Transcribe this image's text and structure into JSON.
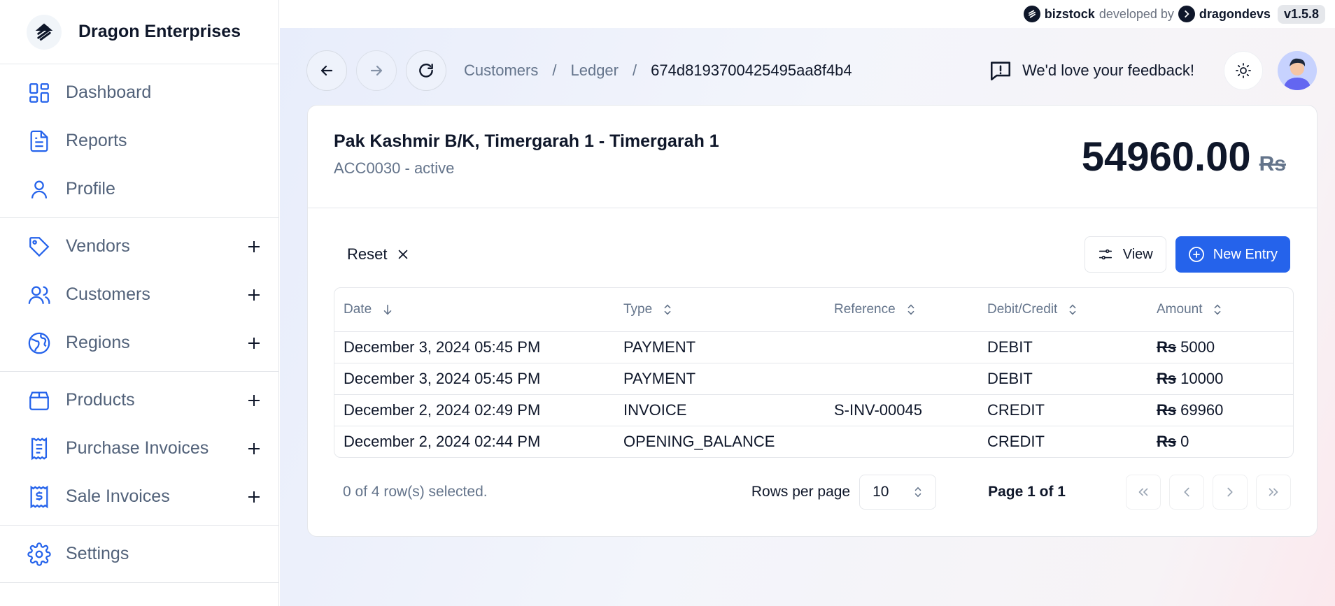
{
  "brand": {
    "name": "Dragon Enterprises"
  },
  "topbar": {
    "product": "bizstock",
    "developed_by": "developed by",
    "developer": "dragondevs",
    "version": "v1.5.8"
  },
  "sidebar": {
    "groups": [
      {
        "items": [
          {
            "label": "Dashboard",
            "icon": "dashboard-icon"
          },
          {
            "label": "Reports",
            "icon": "document-icon"
          },
          {
            "label": "Profile",
            "icon": "user-icon"
          }
        ]
      },
      {
        "items": [
          {
            "label": "Vendors",
            "icon": "tag-icon"
          },
          {
            "label": "Customers",
            "icon": "users-icon"
          },
          {
            "label": "Regions",
            "icon": "globe-icon"
          }
        ]
      },
      {
        "items": [
          {
            "label": "Products",
            "icon": "box-icon"
          },
          {
            "label": "Purchase Invoices",
            "icon": "receipt-icon"
          },
          {
            "label": "Sale Invoices",
            "icon": "dollar-receipt-icon"
          }
        ]
      },
      {
        "items": [
          {
            "label": "Settings",
            "icon": "gear-icon"
          }
        ]
      }
    ]
  },
  "header": {
    "breadcrumbs": [
      "Customers",
      "Ledger",
      "674d8193700425495aa8f4b4"
    ],
    "separator": "/",
    "feedback": "We'd love your feedback!"
  },
  "customer": {
    "name": "Pak Kashmir B/K, Timergarah 1 - Timergarah 1",
    "subtitle": "ACC0030 - active",
    "balance": "54960.00",
    "currency": "Rs"
  },
  "toolbar": {
    "reset": "Reset",
    "view": "View",
    "new_entry": "New Entry"
  },
  "table": {
    "columns": [
      "Date",
      "Type",
      "Reference",
      "Debit/Credit",
      "Amount"
    ],
    "currency": "Rs",
    "rows": [
      {
        "date": "December 3, 2024 05:45 PM",
        "type": "PAYMENT",
        "reference": "",
        "dc": "DEBIT",
        "amount": "5000"
      },
      {
        "date": "December 3, 2024 05:45 PM",
        "type": "PAYMENT",
        "reference": "",
        "dc": "DEBIT",
        "amount": "10000"
      },
      {
        "date": "December 2, 2024 02:49 PM",
        "type": "INVOICE",
        "reference": "S-INV-00045",
        "dc": "CREDIT",
        "amount": "69960"
      },
      {
        "date": "December 2, 2024 02:44 PM",
        "type": "OPENING_BALANCE",
        "reference": "",
        "dc": "CREDIT",
        "amount": "0"
      }
    ]
  },
  "footer": {
    "selection": "0 of 4 row(s) selected.",
    "rows_per_page_label": "Rows per page",
    "rows_per_page": "10",
    "page_info": "Page 1 of 1"
  },
  "colors": {
    "accent": "#2563eb",
    "icon": "#2563eb",
    "text": "#0f172a",
    "muted": "#64748b"
  }
}
